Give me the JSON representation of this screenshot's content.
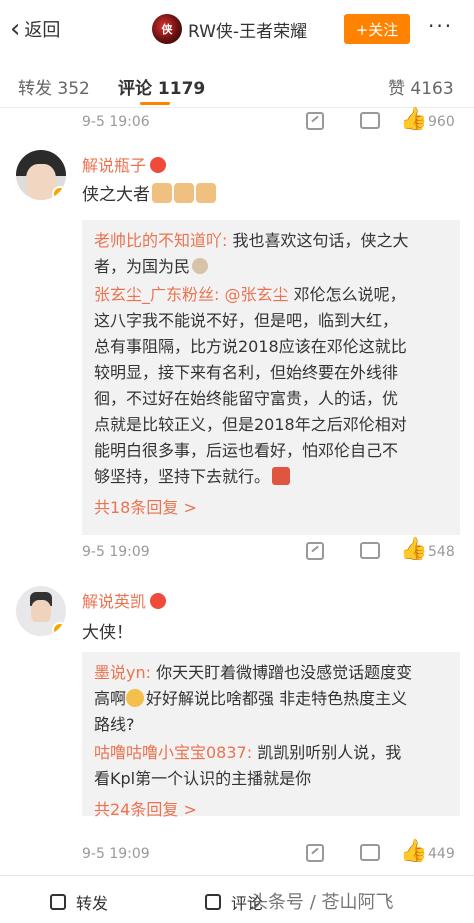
{
  "nav": {
    "back_label": "返回",
    "title": "RW侠-王者荣耀",
    "follow_label": "+关注",
    "more": "···",
    "avatar_text": "侠"
  },
  "tabs": {
    "repost": "转发 352",
    "comments": "评论 1179",
    "likes": "赞 4163"
  },
  "stats": [
    {
      "date": "9-5 19:06",
      "likes": "960"
    },
    {
      "date": "9-5 19:09",
      "likes": "548"
    },
    {
      "date": "9-5 19:09",
      "likes": "449"
    }
  ],
  "comments": [
    {
      "author": "解说瓶子",
      "text": "侠之大者",
      "replies": [
        {
          "user": "老帅比的不知道吖:",
          "lines": [
            "我也喜欢这句话，侠之大",
            "者，为国为民"
          ]
        },
        {
          "user": "张玄尘_广东粉丝:",
          "mention": "@张玄尘",
          "lines": [
            "邓伦怎么说呢，",
            "这八字我不能说不好，但是吧，临到大红，",
            "总有事阻隔，比方说2018应该在邓伦这就比",
            "较明显，接下来有名利，但始终要在外线徘",
            "徊，不过好在始终能留守富贵，人的话，优",
            "点就是比较正义，但是2018年之后邓伦相对",
            "能明白很多事，后运也看好，怕邓伦自己不",
            "够坚持，坚持下去就行。"
          ]
        }
      ],
      "more_replies": "共18条回复 >"
    },
    {
      "author": "解说英凯",
      "text": "大侠！",
      "replies": [
        {
          "user": "墨说yn:",
          "lines": [
            "你天天盯着微博蹭也没感觉话题度变",
            "高啊",
            "好好解说比啥都强  非走特色热度主义",
            "路线?"
          ]
        },
        {
          "user": "咕噜咕噜小宝宝0837:",
          "lines": [
            "凯凯别听别人说，我",
            "看Kpl第一个认识的主播就是你"
          ]
        }
      ],
      "more_replies": "共24条回复 >"
    }
  ],
  "bottom": {
    "repost": "转发",
    "comment": "评论",
    "watermark": "头条号 / 苍山阿飞"
  }
}
